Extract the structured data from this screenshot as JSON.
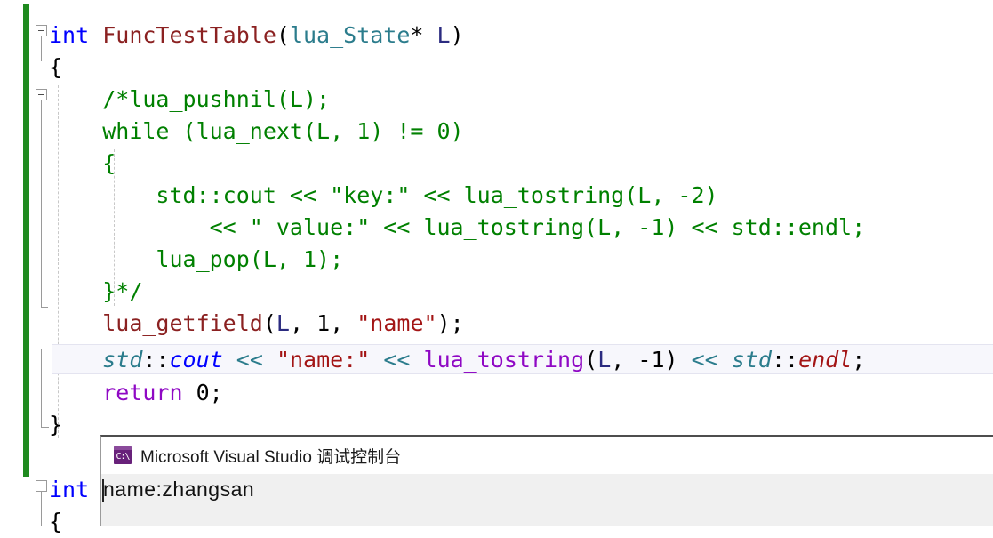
{
  "app": {
    "surface": "visual-studio-cpp-editor",
    "background": "#ffffff"
  },
  "colors": {
    "change_bar_saved": "#1f8a1f",
    "keyword": "#0000ff",
    "function": "#8b2121",
    "type": "#2b7c8c",
    "comment": "#008000",
    "string": "#a31515",
    "control_keyword": "#8f08c4",
    "operator": "#2b7c8c",
    "parameter": "#2b2b80",
    "current_line_bg": "#f7f7fc",
    "console_title_bg": "#ffffff",
    "console_body_bg": "#f0f0f0",
    "console_icon_bg": "#68217a"
  },
  "editor": {
    "lines": [
      {
        "n": 1,
        "indent": 0,
        "fold": "open",
        "tokens": [
          {
            "t": "int",
            "c": "kw"
          },
          {
            "t": " ",
            "c": "punct"
          },
          {
            "t": "FuncTestTable",
            "c": "func"
          },
          {
            "t": "(",
            "c": "punct"
          },
          {
            "t": "lua_State",
            "c": "type"
          },
          {
            "t": "*",
            "c": "punct"
          },
          {
            "t": " ",
            "c": "punct"
          },
          {
            "t": "L",
            "c": "param"
          },
          {
            "t": ")",
            "c": "punct"
          }
        ]
      },
      {
        "n": 2,
        "indent": 0,
        "fold": "none",
        "tokens": [
          {
            "t": "{",
            "c": "punct"
          }
        ]
      },
      {
        "n": 3,
        "indent": 1,
        "fold": "open",
        "tokens": [
          {
            "t": "/*lua_pushnil(L);",
            "c": "comment"
          }
        ]
      },
      {
        "n": 4,
        "indent": 1,
        "fold": "none",
        "tokens": [
          {
            "t": "while (lua_next(L, 1) != 0)",
            "c": "comment"
          }
        ]
      },
      {
        "n": 5,
        "indent": 1,
        "fold": "none",
        "tokens": [
          {
            "t": "{",
            "c": "comment"
          }
        ]
      },
      {
        "n": 6,
        "indent": 2,
        "fold": "none",
        "tokens": [
          {
            "t": "std::cout << \"key:\" << lua_tostring(L, -2)",
            "c": "comment"
          }
        ]
      },
      {
        "n": 7,
        "indent": 3,
        "fold": "none",
        "tokens": [
          {
            "t": "<< \" value:\" << lua_tostring(L, -1) << std::endl;",
            "c": "comment"
          }
        ]
      },
      {
        "n": 8,
        "indent": 2,
        "fold": "none",
        "tokens": [
          {
            "t": "lua_pop(L, 1);",
            "c": "comment"
          }
        ]
      },
      {
        "n": 9,
        "indent": 1,
        "fold": "none",
        "tokens": [
          {
            "t": "}*/",
            "c": "comment"
          }
        ]
      },
      {
        "n": 10,
        "indent": 1,
        "fold": "none",
        "tokens": [
          {
            "t": "lua_getfield",
            "c": "func"
          },
          {
            "t": "(",
            "c": "punct"
          },
          {
            "t": "L",
            "c": "param"
          },
          {
            "t": ", ",
            "c": "punct"
          },
          {
            "t": "1",
            "c": "num"
          },
          {
            "t": ", ",
            "c": "punct"
          },
          {
            "t": "\"name\"",
            "c": "string"
          },
          {
            "t": ");",
            "c": "punct"
          }
        ]
      },
      {
        "n": 11,
        "indent": 1,
        "fold": "none",
        "current": true,
        "tokens": [
          {
            "t": "std",
            "c": "ns it"
          },
          {
            "t": "::",
            "c": "punct"
          },
          {
            "t": "cout",
            "c": "member it"
          },
          {
            "t": " ",
            "c": "punct"
          },
          {
            "t": "<<",
            "c": "op"
          },
          {
            "t": " ",
            "c": "punct"
          },
          {
            "t": "\"name:\"",
            "c": "string"
          },
          {
            "t": " ",
            "c": "punct"
          },
          {
            "t": "<<",
            "c": "op"
          },
          {
            "t": " ",
            "c": "punct"
          },
          {
            "t": "lua_tostring",
            "c": "luafn"
          },
          {
            "t": "(",
            "c": "punct"
          },
          {
            "t": "L",
            "c": "param"
          },
          {
            "t": ", ",
            "c": "punct"
          },
          {
            "t": "-1",
            "c": "num"
          },
          {
            "t": ")",
            "c": "punct"
          },
          {
            "t": " ",
            "c": "punct"
          },
          {
            "t": "<<",
            "c": "op"
          },
          {
            "t": " ",
            "c": "punct"
          },
          {
            "t": "std",
            "c": "ns it"
          },
          {
            "t": "::",
            "c": "punct"
          },
          {
            "t": "endl",
            "c": "endl it"
          },
          {
            "t": ";",
            "c": "punct"
          }
        ]
      },
      {
        "n": 12,
        "indent": 1,
        "fold": "none",
        "tokens": [
          {
            "t": "return",
            "c": "ctrl"
          },
          {
            "t": " ",
            "c": "punct"
          },
          {
            "t": "0",
            "c": "num"
          },
          {
            "t": ";",
            "c": "punct"
          }
        ]
      },
      {
        "n": 13,
        "indent": 0,
        "fold": "none",
        "tokens": [
          {
            "t": "}",
            "c": "punct"
          }
        ]
      },
      {
        "n": 14,
        "indent": 0,
        "fold": "open",
        "tokens": [
          {
            "t": "int",
            "c": "kw"
          }
        ]
      },
      {
        "n": 15,
        "indent": 0,
        "fold": "none",
        "tokens": [
          {
            "t": "{",
            "c": "punct"
          }
        ]
      }
    ]
  },
  "console": {
    "icon": "console-window-icon",
    "icon_glyph": "C:\\",
    "title": "Microsoft Visual Studio 调试控制台",
    "output_lines": [
      "name:zhangsan"
    ]
  }
}
